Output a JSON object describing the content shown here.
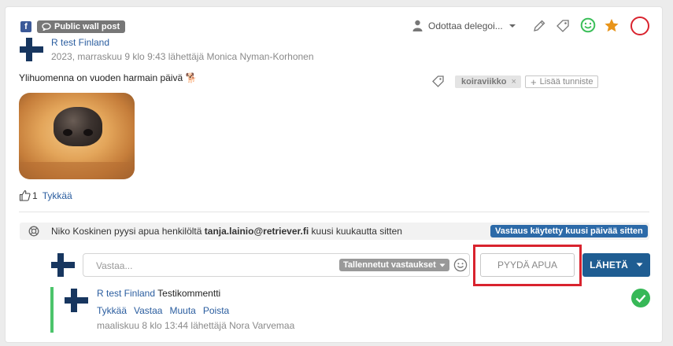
{
  "post": {
    "source_badge": "f",
    "type_label": "Public wall post",
    "author": "R test Finland",
    "meta": "2023, marraskuu 9 klo 9:43 lähettäjä Monica Nyman-Korhonen",
    "status_label": "Odottaa delegoi...",
    "text": "Ylihuomenna on vuoden harmain päivä 🐕",
    "tags": [
      "koiraviikko"
    ],
    "add_tag_label": "Lisää tunniste",
    "like_count": "1",
    "like_label": "Tykkää"
  },
  "help_request": {
    "pre": "Niko Koskinen pyysi apua henkilöltä ",
    "email": "tanja.lainio@retriever.fi",
    "post": " kuusi kuukautta sitten",
    "badge": "Vastaus käytetty kuusi päivää sitten"
  },
  "reply": {
    "placeholder": "Vastaa...",
    "saved_replies_label": "Tallennetut vastaukset",
    "ask_help_label": "PYYDÄ APUA",
    "send_label": "LÄHETÄ"
  },
  "comment": {
    "author": "R test Finland",
    "text": "Testikommentti",
    "actions": [
      "Tykkää",
      "Vastaa",
      "Muuta",
      "Poista"
    ],
    "meta": "maaliskuu 8 klo 13:44 lähettäjä Nora Varvemaa"
  },
  "colors": {
    "brand_blue": "#1f5d92",
    "link_blue": "#2a5d9f",
    "highlight_red": "#d9232e",
    "success_green": "#37b857",
    "star_orange": "#e8941a",
    "smiley_green": "#3cbf5a"
  }
}
